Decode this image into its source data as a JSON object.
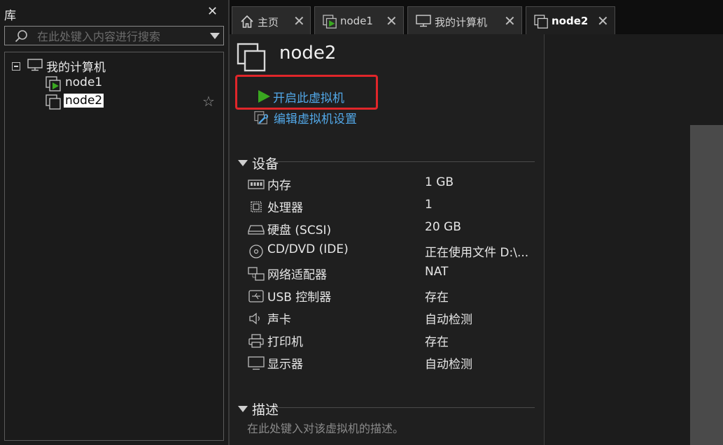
{
  "library": {
    "title": "库",
    "close_glyph": "✕",
    "search_placeholder": "在此处键入内容进行搜索",
    "tree": {
      "root_label": "我的计算机",
      "children": [
        {
          "label": "node1",
          "icon": "vm-running-icon"
        },
        {
          "label": "node2",
          "icon": "vm-icon",
          "selected": true
        }
      ]
    }
  },
  "tabs": [
    {
      "label": "主页",
      "icon": "home-icon",
      "close_glyph": "✕"
    },
    {
      "label": "node1",
      "icon": "vm-running-icon",
      "close_glyph": "✕"
    },
    {
      "label": "我的计算机",
      "icon": "monitor-icon",
      "close_glyph": "✕"
    },
    {
      "label": "node2",
      "icon": "vm-icon",
      "close_glyph": "✕",
      "active": true
    }
  ],
  "vm": {
    "name": "node2",
    "actions": {
      "power_on": "开启此虚拟机",
      "edit_settings": "编辑虚拟机设置"
    },
    "devices_header": "设备",
    "devices": [
      {
        "name": "内存",
        "value": "1 GB",
        "icon": "memory-icon"
      },
      {
        "name": "处理器",
        "value": "1",
        "icon": "cpu-icon"
      },
      {
        "name": "硬盘 (SCSI)",
        "value": "20 GB",
        "icon": "harddisk-icon"
      },
      {
        "name": "CD/DVD (IDE)",
        "value": "正在使用文件 D:\\...",
        "icon": "cd-icon"
      },
      {
        "name": "网络适配器",
        "value": "NAT",
        "icon": "network-icon"
      },
      {
        "name": "USB 控制器",
        "value": "存在",
        "icon": "usb-icon"
      },
      {
        "name": "声卡",
        "value": "自动检测",
        "icon": "speaker-icon"
      },
      {
        "name": "打印机",
        "value": "存在",
        "icon": "printer-icon"
      },
      {
        "name": "显示器",
        "value": "自动检测",
        "icon": "display-icon"
      }
    ],
    "description_header": "描述",
    "description_placeholder": "在此处键入对该虚拟机的描述。"
  },
  "colors": {
    "link": "#52a8e8",
    "highlight": "#e0262a",
    "play_green": "#3aa820"
  }
}
